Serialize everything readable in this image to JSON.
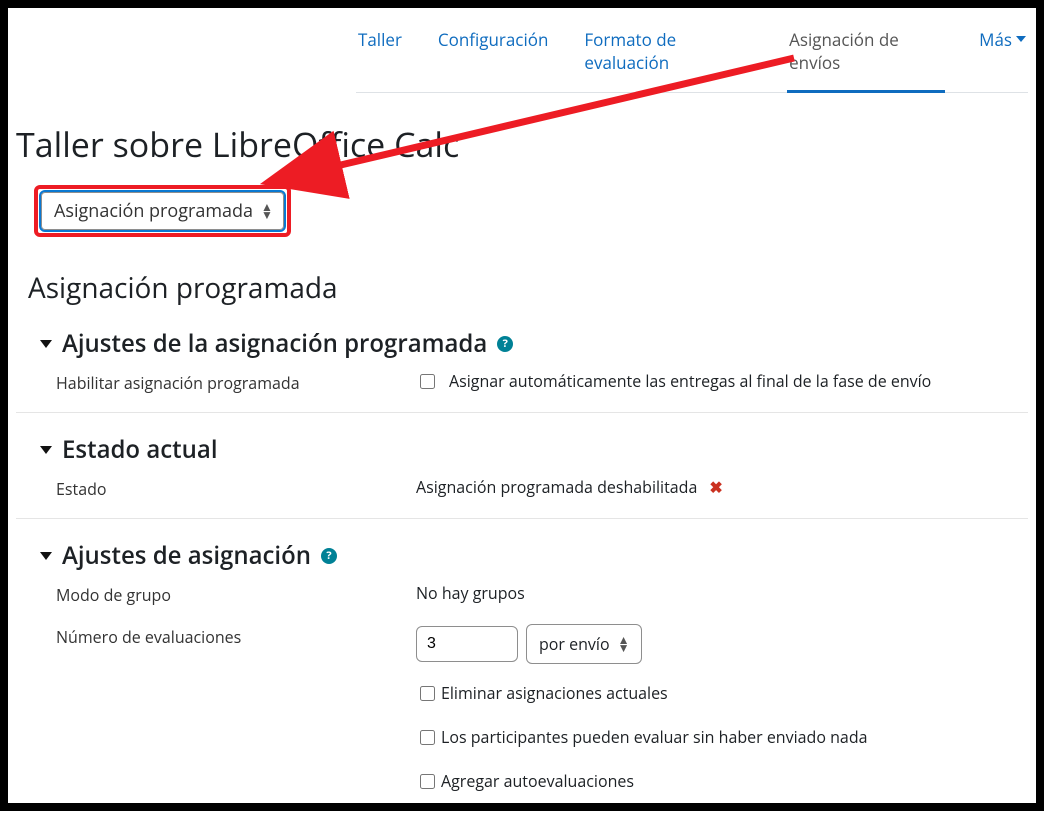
{
  "tabs": [
    "Taller",
    "Configuración",
    "Formato de evaluación",
    "Asignación de envíos",
    "Más"
  ],
  "active_tab_index": 3,
  "page_title": "Taller sobre LibreOffice Calc",
  "method_select": {
    "label": "Asignación programada"
  },
  "subheading": "Asignación programada",
  "sections": {
    "scheduled": {
      "title": "Ajustes de la asignación programada",
      "enable_label": "Habilitar asignación programada",
      "auto_assign_label": "Asignar automáticamente las entregas al final de la fase de envío"
    },
    "status": {
      "title": "Estado actual",
      "state_label": "Estado",
      "state_value": "Asignación programada deshabilitada"
    },
    "assign": {
      "title": "Ajustes de asignación",
      "group_mode_label": "Modo de grupo",
      "group_mode_value": "No hay grupos",
      "num_label": "Número de evaluaciones",
      "num_value": "3",
      "per_select": "por envío",
      "chk_remove": "Eliminar asignaciones actuales",
      "chk_assess_without": "Los participantes pueden evaluar sin haber enviado nada",
      "chk_self": "Agregar autoevaluaciones"
    }
  }
}
